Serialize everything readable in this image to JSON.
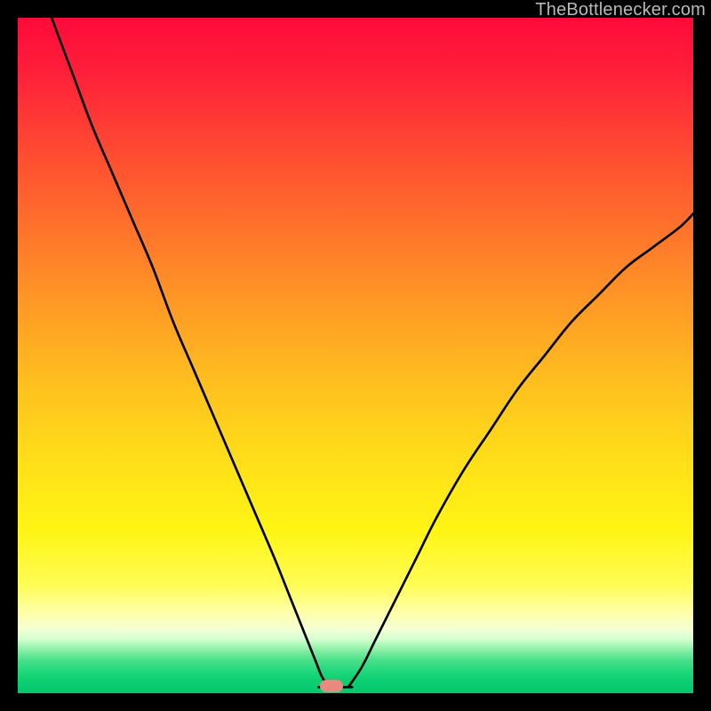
{
  "watermark": "TheBottlenecker.com",
  "marker": {
    "x_pct": 46.5,
    "y_pct": 99.0,
    "color": "#e98a7f"
  },
  "chart_data": {
    "type": "line",
    "title": "",
    "xlabel": "",
    "ylabel": "",
    "xlim": [
      0,
      100
    ],
    "ylim": [
      0,
      100
    ],
    "grid": false,
    "series": [
      {
        "name": "bottleneck-curve-left",
        "x": [
          5,
          8,
          11,
          14,
          17,
          20,
          23,
          26,
          29,
          32,
          35,
          38,
          40,
          42,
          44,
          45,
          46,
          46.5
        ],
        "y": [
          100,
          92,
          84,
          77,
          70,
          63,
          55,
          48,
          41,
          34,
          27,
          20,
          15,
          10,
          5,
          2.5,
          1,
          0.8
        ]
      },
      {
        "name": "bottleneck-curve-right",
        "x": [
          49,
          51,
          53,
          56,
          59,
          62,
          66,
          70,
          74,
          78,
          82,
          86,
          90,
          94,
          98,
          100
        ],
        "y": [
          1,
          4,
          8,
          14,
          20,
          26,
          33,
          39,
          45,
          50,
          55,
          59,
          63,
          66,
          69,
          71
        ]
      },
      {
        "name": "flat-segment",
        "x": [
          44.5,
          49.5
        ],
        "y": [
          0.9,
          0.9
        ]
      }
    ],
    "annotations": [
      {
        "text": "TheBottlenecker.com",
        "pos": "top-right"
      }
    ]
  }
}
